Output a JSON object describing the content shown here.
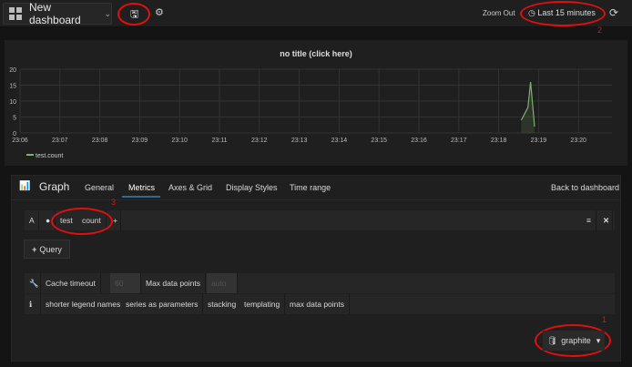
{
  "topbar": {
    "dashboard_title": "New dashboard",
    "zoom_out": "Zoom Out",
    "time_range": "Last 15 minutes"
  },
  "annotations": {
    "n1": "1",
    "n2": "2",
    "n3": "3",
    "color": "#e10f0f"
  },
  "panel": {
    "title": "no title (click here)"
  },
  "chart_data": {
    "type": "line",
    "title": "no title (click here)",
    "ylim": [
      0,
      20
    ],
    "yticks": [
      "0",
      "5",
      "10",
      "15",
      "20"
    ],
    "xticks": [
      "23:06",
      "23:07",
      "23:08",
      "23:09",
      "23:10",
      "23:11",
      "23:12",
      "23:13",
      "23:14",
      "23:15",
      "23:16",
      "23:17",
      "23:18",
      "23:19",
      "23:20"
    ],
    "grid": true,
    "legend": "bottom-left",
    "series": [
      {
        "name": "test.count",
        "color": "#7eb26d",
        "x": [
          "23:18:34",
          "23:18:44",
          "23:18:48",
          "23:18:54"
        ],
        "y": [
          4,
          8,
          16,
          2
        ]
      }
    ]
  },
  "editor": {
    "panel_type": "Graph",
    "tabs": [
      "General",
      "Metrics",
      "Axes & Grid",
      "Display Styles",
      "Time range"
    ],
    "active_tab": "Metrics",
    "back": "Back to dashboard",
    "query": {
      "ref": "A",
      "segments": [
        "test",
        "count"
      ]
    },
    "add_query": "Query",
    "options": {
      "cache_label": "Cache timeout",
      "cache_placeholder": "60",
      "max_label": "Max data points",
      "max_placeholder": "auto"
    },
    "help": [
      "shorter legend names",
      "series as parameters",
      "stacking",
      "templating",
      "max data points"
    ],
    "datasource": "graphite"
  }
}
